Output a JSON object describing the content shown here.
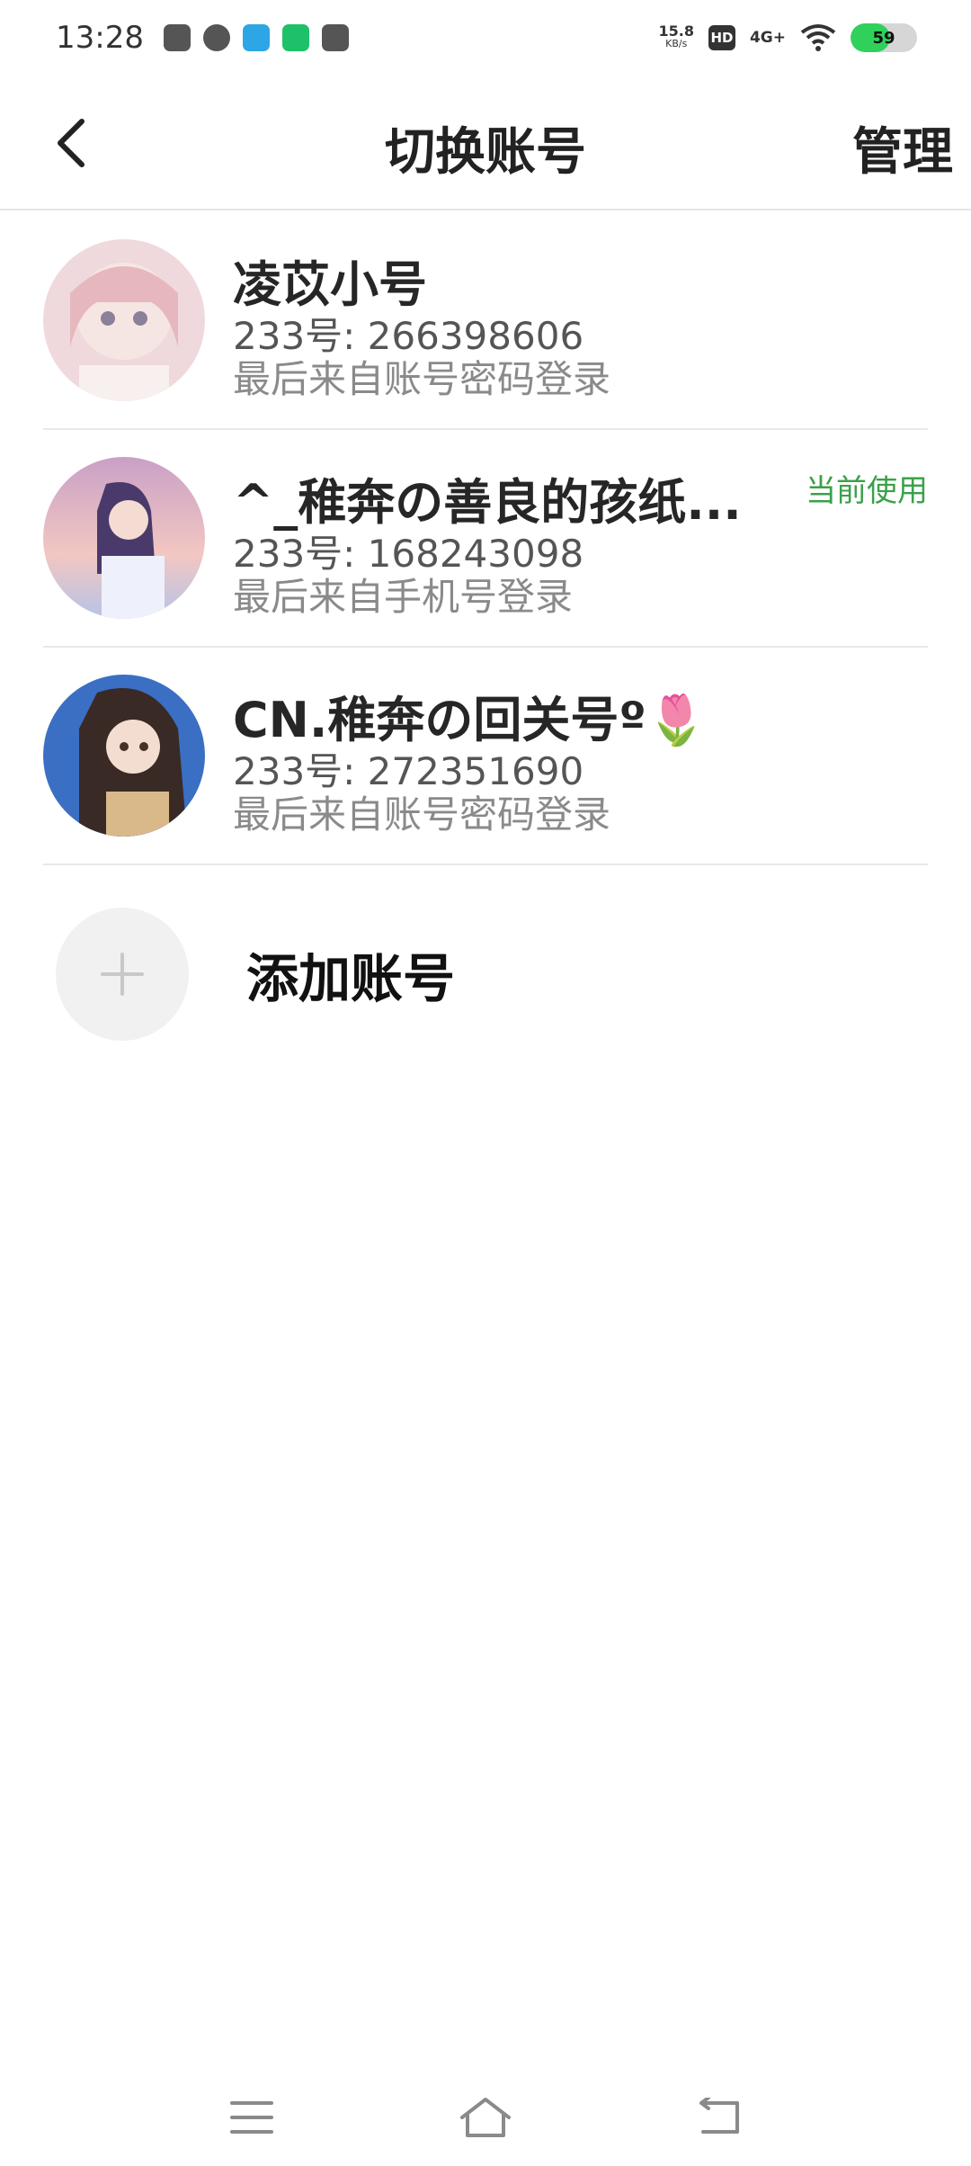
{
  "status_bar": {
    "time": "13:28",
    "netspeed_value": "15.8",
    "netspeed_unit": "KB/s",
    "hd": "HD",
    "network": "4G+",
    "battery": "59",
    "battery_level": 0.59,
    "app_icons": [
      "wechat-icon",
      "gauge-icon",
      "telegram-icon",
      "iqiyi-icon",
      "shop-bag-icon"
    ]
  },
  "header": {
    "title": "切换账号",
    "manage": "管理"
  },
  "accounts": [
    {
      "name": "凌苡小号",
      "id": "233号: 266398606",
      "login": "最后来自账号密码登录",
      "current": ""
    },
    {
      "name": "^_稚奔の善良的孩纸...",
      "id": "233号: 168243098",
      "login": "最后来自手机号登录",
      "current": "当前使用"
    },
    {
      "name": "CN.稚奔の回关号º🌷",
      "id": "233号: 272351690",
      "login": "最后来自账号密码登录",
      "current": ""
    }
  ],
  "add_account": {
    "label": "添加账号"
  },
  "colors": {
    "accent_green": "#3aa14a",
    "divider": "#e8e8e8"
  }
}
